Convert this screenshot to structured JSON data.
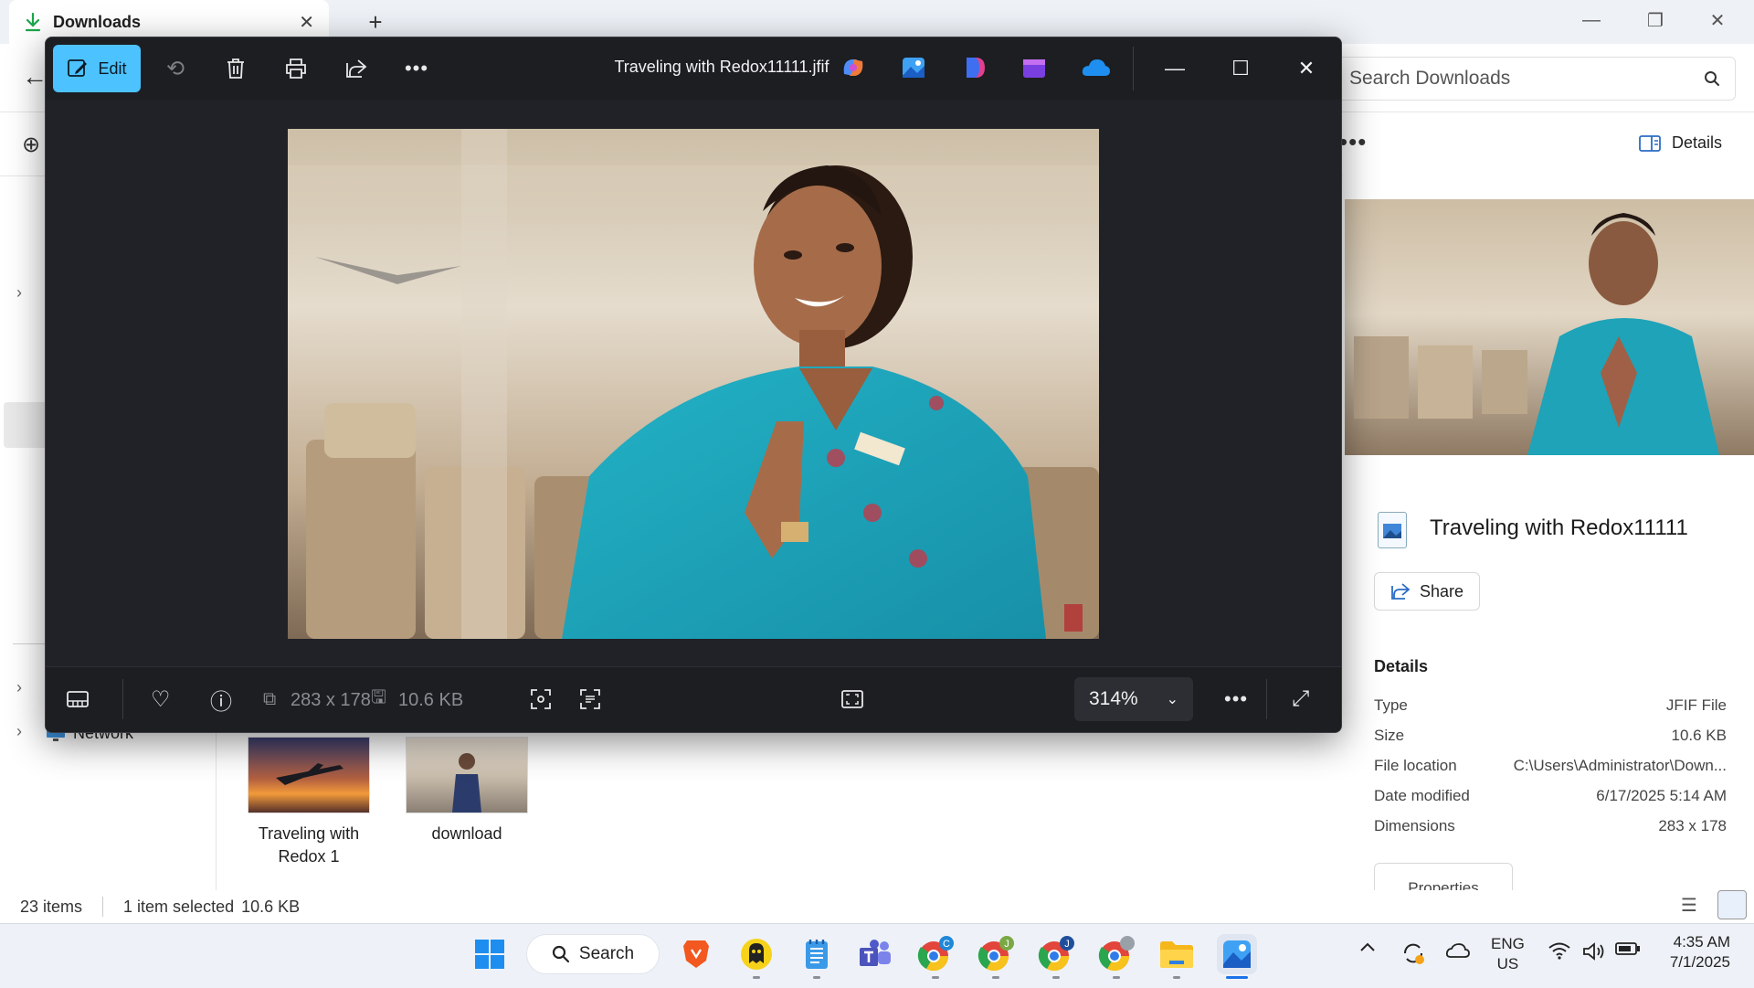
{
  "explorer": {
    "tab_title": "Downloads",
    "new_tab_glyph": "+",
    "search_placeholder": "Search Downloads",
    "more_glyph": "•••",
    "details_button_label": "Details",
    "network_label": "Network",
    "files": [
      {
        "name": "Traveling with Redox 1"
      },
      {
        "name": "download"
      }
    ],
    "status": {
      "items_count": "23 items",
      "selected": "1 item selected",
      "selected_size": "10.6 KB"
    },
    "details_pane": {
      "file_name": "Traveling with Redox11111",
      "share_label": "Share",
      "heading": "Details",
      "rows": [
        {
          "label": "Type",
          "value": "JFIF File"
        },
        {
          "label": "Size",
          "value": "10.6 KB"
        },
        {
          "label": "File location",
          "value": "C:\\Users\\Administrator\\Down..."
        },
        {
          "label": "Date modified",
          "value": "6/17/2025 5:14 AM"
        },
        {
          "label": "Dimensions",
          "value": "283 x 178"
        }
      ],
      "properties_label": "Properties"
    }
  },
  "viewer": {
    "edit_label": "Edit",
    "title": "Traveling with Redox11111.jfif",
    "dimensions": "283 x 178",
    "file_size": "10.6 KB",
    "zoom": "314%",
    "accent_color": "#4cc2ff"
  },
  "taskbar": {
    "search_label": "Search",
    "lang_line1": "ENG",
    "lang_line2": "US",
    "time": "4:35 AM",
    "date": "7/1/2025",
    "chrome_badges": [
      "C",
      "J",
      "J"
    ]
  },
  "icons": {
    "viewer_toolbar": [
      "edit-icon",
      "rotate-icon",
      "delete-icon",
      "print-icon",
      "share-icon",
      "more-icon"
    ],
    "viewer_apps": [
      "copilot-icon",
      "photos-icon",
      "designer-icon",
      "clipchamp-icon",
      "onedrive-icon"
    ],
    "viewer_bottom": [
      "filmstrip-icon",
      "favorite-icon",
      "info-icon",
      "dimensions-icon",
      "save-icon",
      "visual-search-icon",
      "text-scan-icon",
      "fit-icon",
      "more-icon",
      "fullscreen-icon"
    ],
    "taskbar": [
      "start-icon",
      "search-icon",
      "brave-icon",
      "cyberghost-icon",
      "notepad-icon",
      "teams-icon",
      "chrome-icon",
      "file-explorer-icon",
      "photos-icon"
    ]
  }
}
